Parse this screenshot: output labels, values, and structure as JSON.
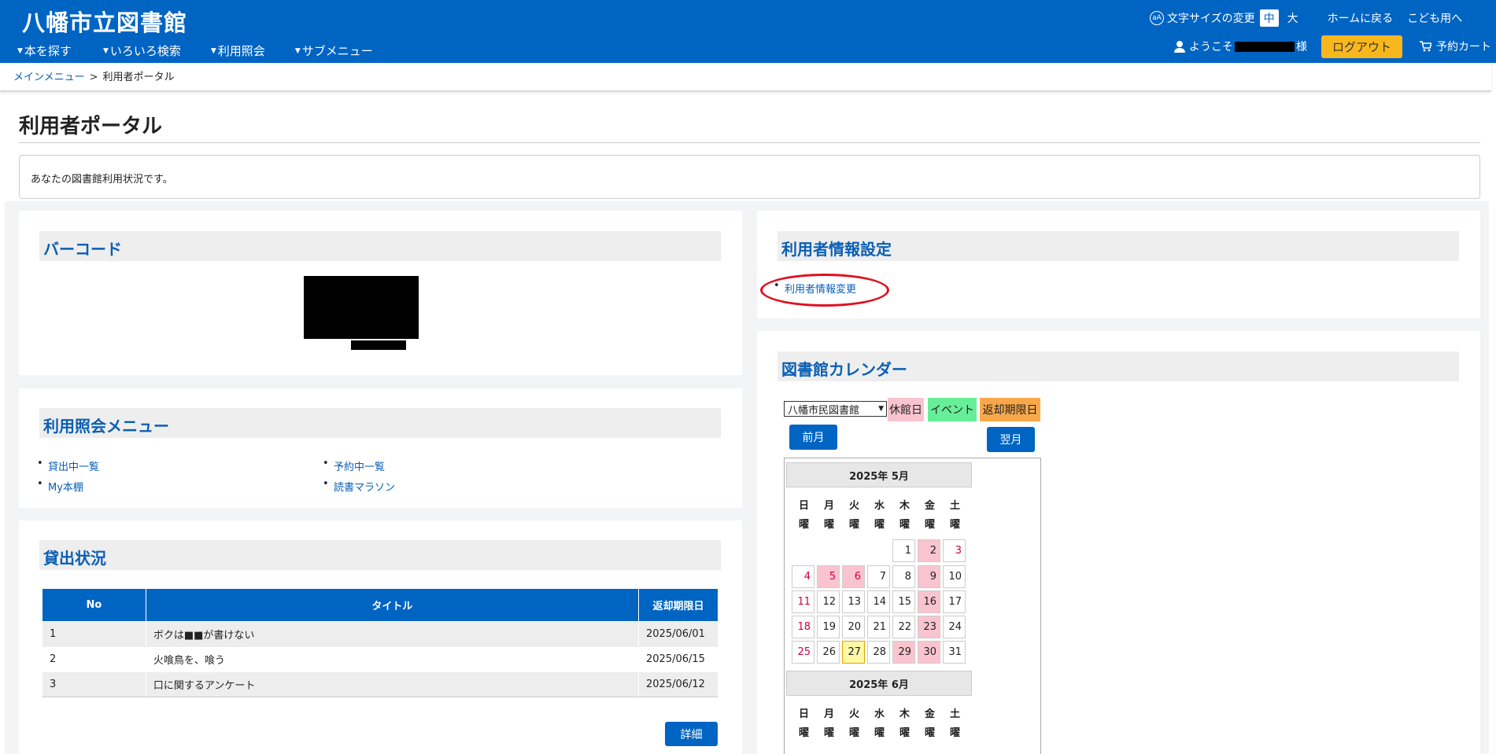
{
  "header": {
    "site_title": "八幡市立図書館",
    "nav": [
      "本を探す",
      "いろいろ検索",
      "利用照会",
      "サブメニュー"
    ],
    "fontsize_label": "文字サイズの変更",
    "fontsize_medium": "中",
    "fontsize_large": "大",
    "home_label": "ホームに戻る",
    "kids_label": "こども用へ",
    "welcome_prefix": "ようこそ",
    "welcome_suffix": "様",
    "logout_label": "ログアウト",
    "cart_label": "予約カート",
    "fontsize_icon": "text-size-icon",
    "colors": {
      "brand": "#0064c3",
      "logout": "#f7b71d"
    }
  },
  "breadcrumb": {
    "home": "メインメニュー",
    "separator": ">",
    "current": "利用者ポータル"
  },
  "page": {
    "title": "利用者ポータル",
    "intro": "あなたの図書館利用状況です。"
  },
  "barcode": {
    "heading": "バーコード"
  },
  "usage_menu": {
    "heading": "利用照会メニュー",
    "items": [
      "貸出中一覧",
      "予約中一覧",
      "My本棚",
      "読書マラソン"
    ]
  },
  "loans": {
    "heading": "貸出状況",
    "columns": [
      "No",
      "タイトル",
      "返却期限日"
    ],
    "rows": [
      {
        "no": "1",
        "title": "ボクは■■が書けない",
        "due": "2025/06/01"
      },
      {
        "no": "2",
        "title": "火喰鳥を、喰う",
        "due": "2025/06/15"
      },
      {
        "no": "3",
        "title": "口に関するアンケート",
        "due": "2025/06/12"
      }
    ],
    "detail_label": "詳細"
  },
  "user_settings": {
    "heading": "利用者情報設定",
    "link": "利用者情報変更"
  },
  "calendar": {
    "heading": "図書館カレンダー",
    "library_selected": "八幡市民図書館",
    "legend": [
      {
        "label": "休館日",
        "color": "#f9c4d0"
      },
      {
        "label": "イベント",
        "color": "#66ee99"
      },
      {
        "label": "返却期限日",
        "color": "#f8a84a"
      }
    ],
    "prev_label": "前月",
    "next_label": "翌月",
    "weekdays": [
      "日",
      "月",
      "火",
      "水",
      "木",
      "金",
      "土"
    ],
    "weekday_suffix": "曜",
    "months": [
      {
        "title": "2025年 5月",
        "first_weekday": 4,
        "days": 31,
        "closed": [
          2,
          5,
          6,
          9,
          16,
          23,
          29,
          30
        ],
        "red": [
          3,
          4,
          5,
          6,
          11,
          18,
          25
        ],
        "today": 27
      },
      {
        "title": "2025年 6月"
      }
    ]
  }
}
